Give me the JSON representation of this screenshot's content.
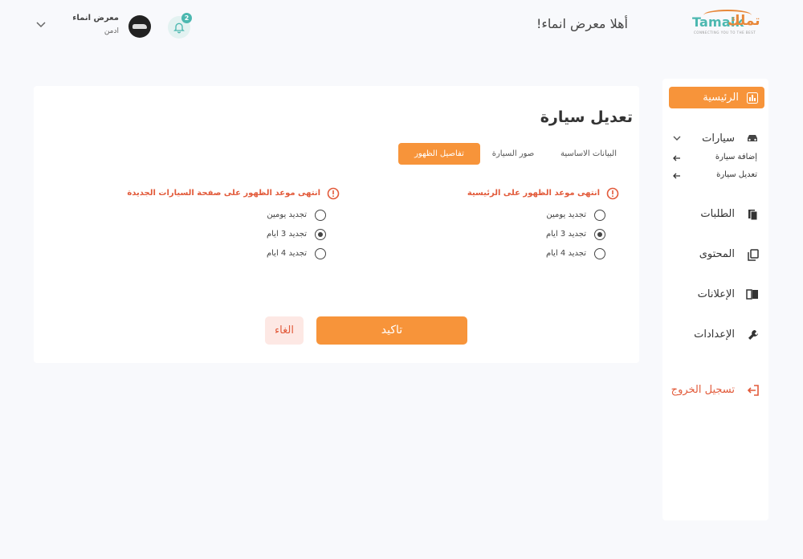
{
  "brand": {
    "logo_text": "Tamalk",
    "logo_arabic": "تملك",
    "logo_tagline": "CONNECTING YOU TO THE BEST"
  },
  "header": {
    "greeting": "أهلا معرض انماء!",
    "notification_count": "2"
  },
  "user": {
    "name": "معرض انماء",
    "role": "ادمن"
  },
  "sidebar": {
    "home": "الرئيسية",
    "cars": "سيارات",
    "cars_sub": [
      "إضافة سيارة",
      "تعديل سيارة"
    ],
    "requests": "الطلبات",
    "content": "المحتوى",
    "ads": "الإعلانات",
    "settings": "الإعدادات",
    "logout": "تسجيل الخروج"
  },
  "main": {
    "title": "تعديل سيارة",
    "tabs": [
      "البيانات الاساسية",
      "صور السيارة",
      "تفاصيل الظهور"
    ],
    "active_tab": 2,
    "sections": [
      {
        "heading": "انتهى موعد الظهور على الرئيسية",
        "options": [
          "تجديد يومين",
          "تجديد 3 ايام",
          "تجديد 4 ايام"
        ],
        "selected": 1
      },
      {
        "heading": "انتهى موعد الظهور على صفحة السيارات الجديدة",
        "options": [
          "تجديد يومين",
          "تجديد 3 ايام",
          "تجديد 4 ايام"
        ],
        "selected": 1
      }
    ],
    "confirm_label": "تاكيد",
    "cancel_label": "الغاء"
  },
  "colors": {
    "accent": "#f7943a",
    "teal": "#4cb8b0",
    "danger": "#e25a3a"
  }
}
